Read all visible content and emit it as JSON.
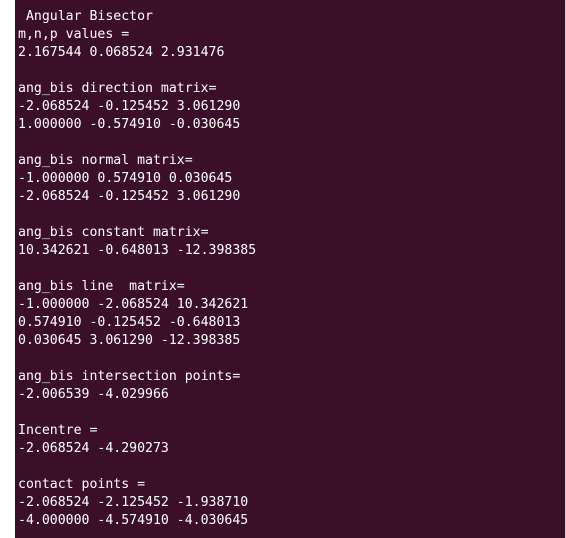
{
  "terminal": {
    "lines": [
      " Angular Bisector",
      "m,n,p values =",
      "2.167544 0.068524 2.931476",
      "",
      "ang_bis direction matrix=",
      "-2.068524 -0.125452 3.061290",
      "1.000000 -0.574910 -0.030645",
      "",
      "ang_bis normal matrix=",
      "-1.000000 0.574910 0.030645",
      "-2.068524 -0.125452 3.061290",
      "",
      "ang_bis constant matrix=",
      "10.342621 -0.648013 -12.398385",
      "",
      "ang_bis line  matrix=",
      "-1.000000 -2.068524 10.342621",
      "0.574910 -0.125452 -0.648013",
      "0.030645 3.061290 -12.398385",
      "",
      "ang_bis intersection points=",
      "-2.006539 -4.029966",
      "",
      "Incentre =",
      "-2.068524 -4.290273",
      "",
      "contact points =",
      "-2.068524 -2.125452 -1.938710",
      "-4.000000 -4.574910 -4.030645"
    ]
  },
  "colors": {
    "terminal_background": "#3b0f2a",
    "terminal_text": "#ffffff"
  }
}
